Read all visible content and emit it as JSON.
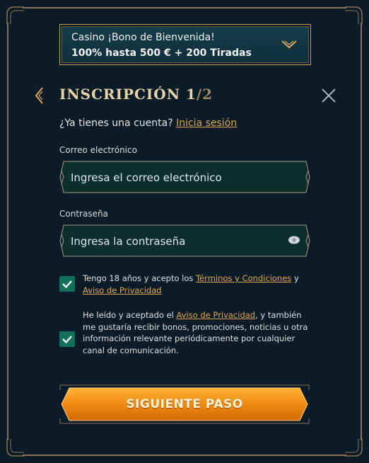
{
  "bonus": {
    "line1": "Casino ¡Bono de Bienvenida!",
    "line2": "100% hasta 500 € + 200 Tiradas"
  },
  "header": {
    "title_main": "INSCRIPCIÓN 1",
    "title_total": "/2"
  },
  "account": {
    "prompt": "¿Ya tienes una cuenta?",
    "login_link": "Inicia sesión"
  },
  "email": {
    "label": "Correo electrónico",
    "placeholder": "Ingresa el correo electrónico",
    "value": ""
  },
  "password": {
    "label": "Contraseña",
    "placeholder": "Ingresa la contraseña",
    "value": ""
  },
  "consent_terms": {
    "checked": true,
    "text_before": "Tengo 18 años y acepto los ",
    "terms_link": "Términos y Condiciones",
    "text_mid": " y ",
    "privacy_link": "Aviso de Privacidad"
  },
  "consent_marketing": {
    "checked": true,
    "text_before": "He leído y aceptado el ",
    "privacy_link": "Aviso de Privacidad",
    "text_after": ", y también me gustaría recibir bonos, promociones, noticias u otra información relevante periódicamente por cualquier canal de comunicación."
  },
  "cta": {
    "label": "SIGUIENTE PASO"
  },
  "colors": {
    "background": "#0b1b27",
    "gold_frame": "#8a7352",
    "accent_link": "#e2a64e",
    "checkbox": "#12705a",
    "field_bg": "#0c2f2e",
    "cta_orange": "#f08a12"
  },
  "icons": {
    "back": "chevron-left-icon",
    "close": "close-icon",
    "bonus_toggle": "chevron-down-icon",
    "password_toggle": "eye-icon",
    "check": "check-icon"
  }
}
